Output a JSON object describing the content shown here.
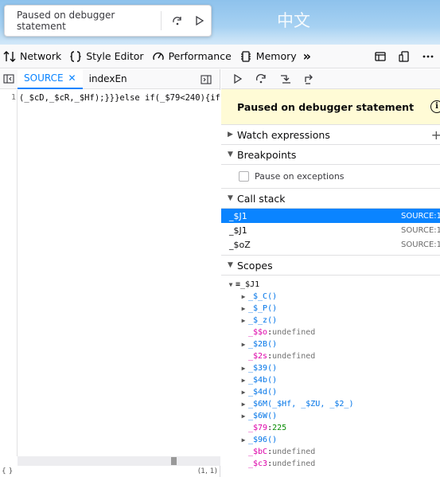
{
  "page": {
    "zh_text": "中文"
  },
  "paused_popup": {
    "message": "Paused on debugger statement"
  },
  "toolbox": {
    "tabs": [
      {
        "label": "Network",
        "icon": "network-icon"
      },
      {
        "label": "Style Editor",
        "icon": "style-editor-icon"
      },
      {
        "label": "Performance",
        "icon": "performance-icon"
      },
      {
        "label": "Memory",
        "icon": "memory-icon"
      }
    ],
    "overflow": "»"
  },
  "editor": {
    "tabs": [
      {
        "label": "SOURCE",
        "active": true
      },
      {
        "label": "indexEn",
        "active": false
      }
    ],
    "line_number": "1",
    "code": "(_$cD,_$cR,_$Hf);}}}else if(_$79<240){if(",
    "status_left": "{ }",
    "status_right": "(1, 1)"
  },
  "debugger": {
    "paused_message": "Paused on debugger statement",
    "sections": {
      "watch": "Watch expressions",
      "breakpoints": "Breakpoints",
      "pause_exceptions": "Pause on exceptions",
      "call_stack": "Call stack",
      "scopes": "Scopes"
    },
    "frames": [
      {
        "name": "_$J1",
        "location": "SOURCE:1",
        "selected": true
      },
      {
        "name": "_$J1",
        "location": "SOURCE:1",
        "selected": false
      },
      {
        "name": "_$oZ",
        "location": "SOURCE:1",
        "selected": false
      }
    ],
    "scope_root": "_$J1",
    "scopes": [
      {
        "name": "_$_C",
        "kind": "fn",
        "display": "()",
        "expandable": true
      },
      {
        "name": "_$_P",
        "kind": "fn",
        "display": "()",
        "expandable": true
      },
      {
        "name": "_$_z",
        "kind": "fn",
        "display": "()",
        "expandable": true
      },
      {
        "name": "_$$o",
        "kind": "val",
        "display": "undefined",
        "expandable": false
      },
      {
        "name": "_$2B",
        "kind": "fn",
        "display": "()",
        "expandable": true
      },
      {
        "name": "_$2s",
        "kind": "val",
        "display": "undefined",
        "expandable": false
      },
      {
        "name": "_$39",
        "kind": "fn",
        "display": "()",
        "expandable": true
      },
      {
        "name": "_$4b",
        "kind": "fn",
        "display": "()",
        "expandable": true
      },
      {
        "name": "_$4d",
        "kind": "fn",
        "display": "()",
        "expandable": true
      },
      {
        "name": "_$6M",
        "kind": "fn",
        "display": "(_$Hf, _$ZU, _$2_)",
        "expandable": true
      },
      {
        "name": "_$6W",
        "kind": "fn",
        "display": "()",
        "expandable": true
      },
      {
        "name": "_$79",
        "kind": "num",
        "display": "225",
        "expandable": false
      },
      {
        "name": "_$96",
        "kind": "fn",
        "display": "()",
        "expandable": true
      },
      {
        "name": "_$bC",
        "kind": "val",
        "display": "undefined",
        "expandable": false
      },
      {
        "name": "_$c3",
        "kind": "val",
        "display": "undefined",
        "expandable": false
      }
    ]
  }
}
